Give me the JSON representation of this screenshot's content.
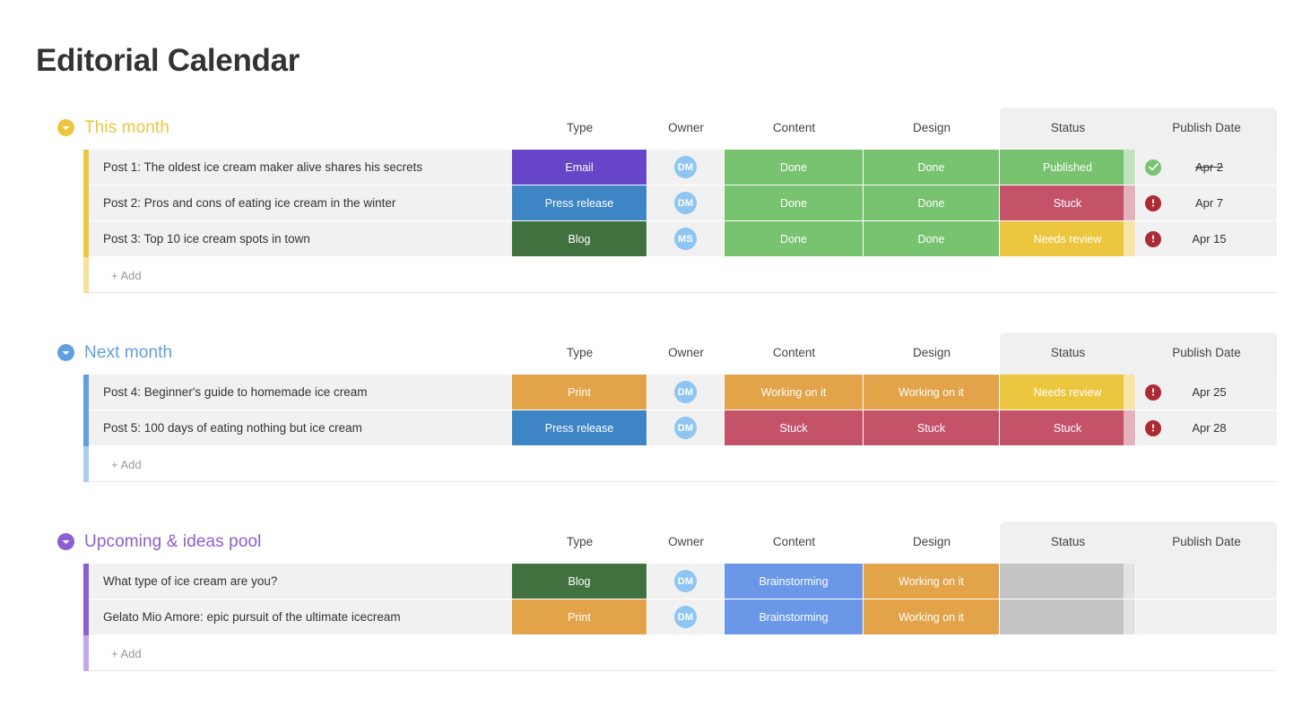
{
  "page": {
    "title": "Editorial Calendar"
  },
  "columns": [
    "Type",
    "Owner",
    "Content",
    "Design",
    "Status",
    "Publish Date"
  ],
  "labels": {
    "add": "+ Add"
  },
  "colors": {
    "email": "#6645c9",
    "press_release": "#3e85c6",
    "blog": "#41713f",
    "print": "#e2a349",
    "done": "#77c36f",
    "working_on_it": "#e2a349",
    "stuck": "#c4536a",
    "published": "#77c36f",
    "needs_review": "#edc63f",
    "brainstorming": "#6a97e8",
    "empty": "#c4c4c4",
    "group_this_month": "#edc63f",
    "group_next_month": "#5f9fe3",
    "group_upcoming": "#8a5fd1",
    "avatar": "#8ec5f2",
    "status_done_icon": "#77c36f",
    "status_alert_icon": "#ab2b35"
  },
  "groups": [
    {
      "name": "This month",
      "color": "#edc63f",
      "bar_color": "#edc63f",
      "add_bar_color": "#f5e199",
      "caret_icon": "chevron-down-icon",
      "rows": [
        {
          "name": "Post 1: The oldest ice cream maker alive shares his secrets",
          "type": "Email",
          "type_color": "#6645c9",
          "owner": "DM",
          "content": "Done",
          "content_color": "#77c36f",
          "design": "Done",
          "design_color": "#77c36f",
          "status": "Published",
          "status_color": "#77c36f",
          "date": "Apr 2",
          "date_struck": true,
          "date_icon": "check-circle-icon",
          "date_icon_color": "#77c36f"
        },
        {
          "name": "Post 2: Pros and cons of eating ice cream in the winter",
          "type": "Press release",
          "type_color": "#3e85c6",
          "owner": "DM",
          "content": "Done",
          "content_color": "#77c36f",
          "design": "Done",
          "design_color": "#77c36f",
          "status": "Stuck",
          "status_color": "#c4536a",
          "date": "Apr 7",
          "date_struck": false,
          "date_icon": "alert-circle-icon",
          "date_icon_color": "#ab2b35"
        },
        {
          "name": "Post 3: Top 10 ice cream spots in town",
          "type": "Blog",
          "type_color": "#41713f",
          "owner": "MS",
          "content": "Done",
          "content_color": "#77c36f",
          "design": "Done",
          "design_color": "#77c36f",
          "status": "Needs review",
          "status_color": "#edc63f",
          "date": "Apr 15",
          "date_struck": false,
          "date_icon": "alert-circle-icon",
          "date_icon_color": "#ab2b35"
        }
      ]
    },
    {
      "name": "Next month",
      "color": "#5f9fe3",
      "bar_color": "#5f9fe3",
      "add_bar_color": "#aecdf1",
      "caret_icon": "chevron-down-icon",
      "rows": [
        {
          "name": "Post 4: Beginner's guide to homemade ice cream",
          "type": "Print",
          "type_color": "#e2a349",
          "owner": "DM",
          "content": "Working on it",
          "content_color": "#e2a349",
          "design": "Working on it",
          "design_color": "#e2a349",
          "status": "Needs review",
          "status_color": "#edc63f",
          "date": "Apr 25",
          "date_struck": false,
          "date_icon": "alert-circle-icon",
          "date_icon_color": "#ab2b35"
        },
        {
          "name": "Post 5: 100 days of eating nothing but ice cream",
          "type": "Press release",
          "type_color": "#3e85c6",
          "owner": "DM",
          "content": "Stuck",
          "content_color": "#c4536a",
          "design": "Stuck",
          "design_color": "#c4536a",
          "status": "Stuck",
          "status_color": "#c4536a",
          "date": "Apr 28",
          "date_struck": false,
          "date_icon": "alert-circle-icon",
          "date_icon_color": "#ab2b35"
        }
      ]
    },
    {
      "name": "Upcoming & ideas pool",
      "color": "#8a5fd1",
      "bar_color": "#8a5fd1",
      "add_bar_color": "#c4a8ea",
      "caret_icon": "chevron-down-icon",
      "rows": [
        {
          "name": "What type of ice cream are you?",
          "type": "Blog",
          "type_color": "#41713f",
          "owner": "DM",
          "content": "Brainstorming",
          "content_color": "#6a97e8",
          "design": "Working on it",
          "design_color": "#e2a349",
          "status": "",
          "status_color": "#c4c4c4",
          "date": "",
          "date_struck": false,
          "date_icon": "",
          "date_icon_color": ""
        },
        {
          "name": "Gelato Mio Amore: epic pursuit of the ultimate icecream",
          "type": "Print",
          "type_color": "#e2a349",
          "owner": "DM",
          "content": "Brainstorming",
          "content_color": "#6a97e8",
          "design": "Working on it",
          "design_color": "#e2a349",
          "status": "",
          "status_color": "#c4c4c4",
          "date": "",
          "date_struck": false,
          "date_icon": "",
          "date_icon_color": ""
        }
      ]
    }
  ]
}
